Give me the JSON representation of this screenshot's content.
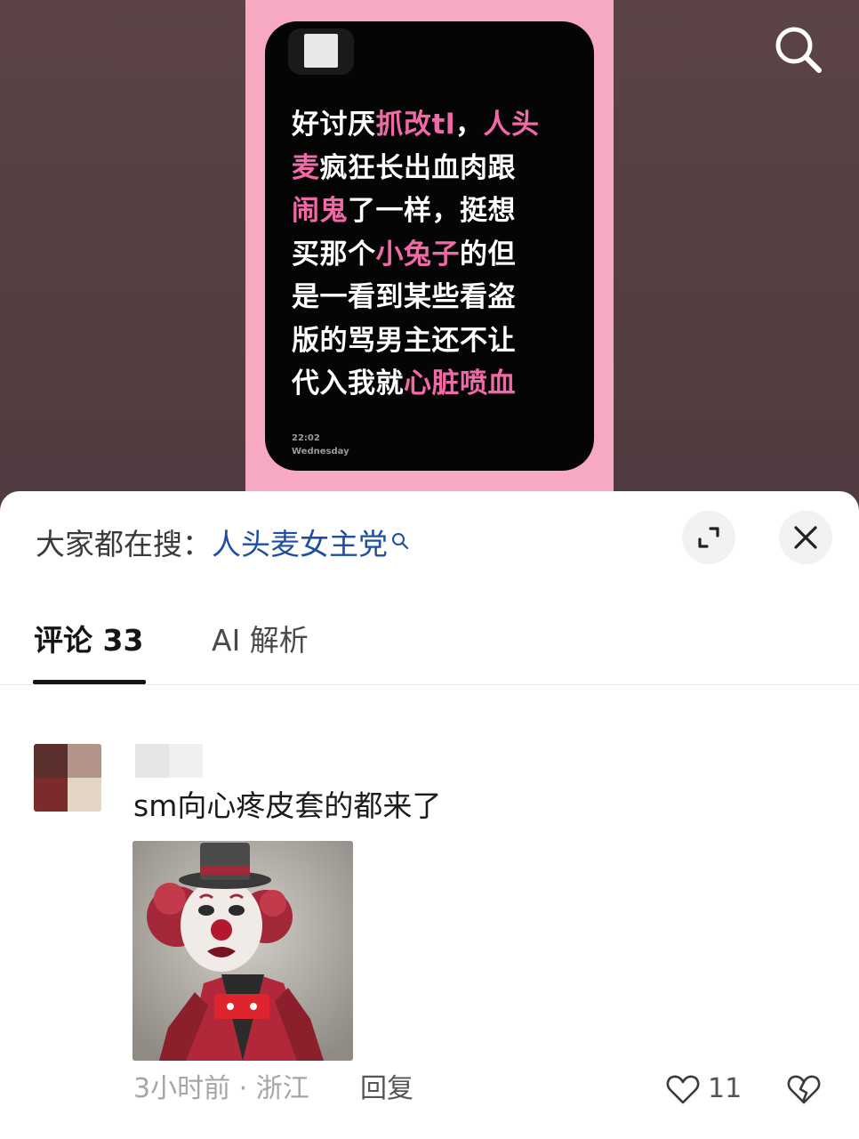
{
  "post": {
    "time": "22:02",
    "weekday": "Wednesday",
    "lines": [
      [
        {
          "t": "好讨厌",
          "hl": false
        },
        {
          "t": "抓改tl",
          "hl": true
        },
        {
          "t": "，",
          "hl": false
        },
        {
          "t": "人头",
          "hl": true
        }
      ],
      [
        {
          "t": "麦",
          "hl": true
        },
        {
          "t": "疯狂长出血肉跟",
          "hl": false
        }
      ],
      [
        {
          "t": "闹鬼",
          "hl": true
        },
        {
          "t": "了一样，挺想",
          "hl": false
        }
      ],
      [
        {
          "t": "买那个",
          "hl": false
        },
        {
          "t": "小兔子",
          "hl": true
        },
        {
          "t": "的但",
          "hl": false
        }
      ],
      [
        {
          "t": "是一看到某些看盗",
          "hl": false
        }
      ],
      [
        {
          "t": "版的骂男主还不让",
          "hl": false
        }
      ],
      [
        {
          "t": "代入我就",
          "hl": false
        },
        {
          "t": "心脏喷血",
          "hl": true
        }
      ]
    ]
  },
  "hot_search": {
    "prefix": "大家都在搜：",
    "keyword": "人头麦女主党"
  },
  "tabs": {
    "comments": "评论 33",
    "ai": "AI 解析"
  },
  "comment": {
    "text": "sm向心疼皮套的都来了",
    "meta": "3小时前 · 浙江",
    "reply": "回复",
    "likes": "11"
  },
  "icons": {
    "search": "search-icon",
    "expand": "expand-icon",
    "close": "close-icon",
    "like": "heart-outline-icon",
    "dislike": "broken-heart-icon"
  },
  "colors": {
    "highlight": "#f06aa8",
    "keyword": "#1e4fa3",
    "pink_bg": "#f6a9c1"
  }
}
